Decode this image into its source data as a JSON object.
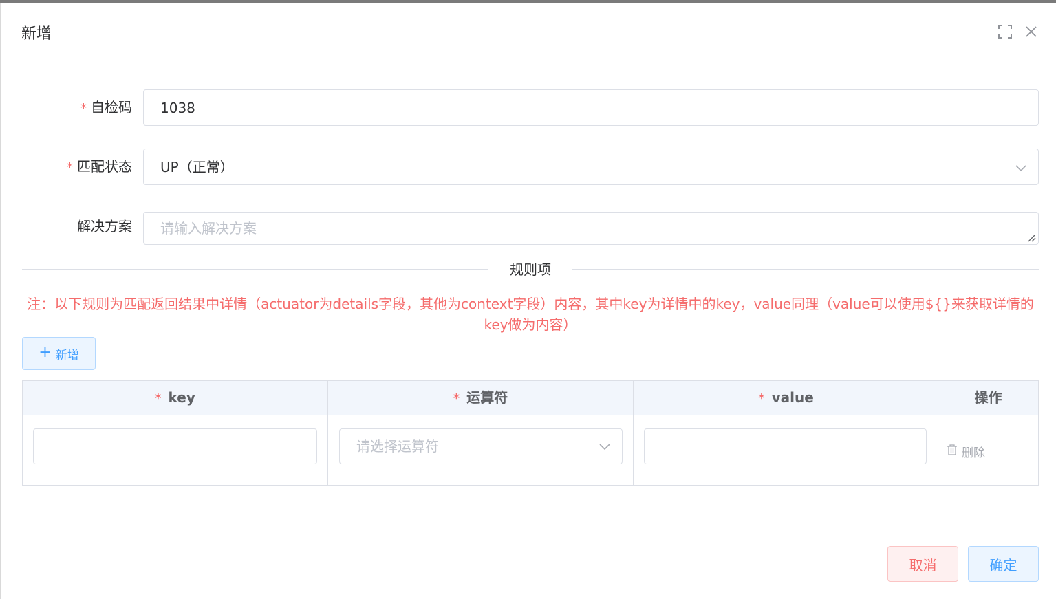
{
  "dialog": {
    "title": "新增"
  },
  "form": {
    "code": {
      "label": "自检码",
      "value": "1038",
      "required": true
    },
    "status": {
      "label": "匹配状态",
      "value": "UP（正常）",
      "required": true
    },
    "solution": {
      "label": "解决方案",
      "value": "",
      "placeholder": "请输入解决方案"
    }
  },
  "divider": {
    "label": "规则项"
  },
  "note": {
    "text": "注：以下规则为匹配返回结果中详情（actuator为details字段，其他为context字段）内容，其中key为详情中的key，value同理（value可以使用${}来获取详情的key做为内容）"
  },
  "add_button": {
    "label": "新增"
  },
  "table": {
    "columns": [
      {
        "label": "key",
        "required": true
      },
      {
        "label": "运算符",
        "required": true
      },
      {
        "label": "value",
        "required": true
      },
      {
        "label": "操作",
        "required": false
      }
    ],
    "rows": [
      {
        "key": "",
        "operator_placeholder": "请选择运算符",
        "value": "",
        "action_label": "删除"
      }
    ]
  },
  "footer": {
    "cancel_label": "取消",
    "confirm_label": "确定"
  },
  "icons": [
    "fullscreen-icon",
    "close-icon",
    "chevron-down-icon",
    "plus-icon",
    "trash-icon",
    "resize-handle-icon"
  ],
  "colors": {
    "required": "#f56c6c",
    "primary": "#409eff",
    "danger": "#f56c6c",
    "header_bg": "#f2f6fc",
    "border": "#dcdfe6"
  }
}
